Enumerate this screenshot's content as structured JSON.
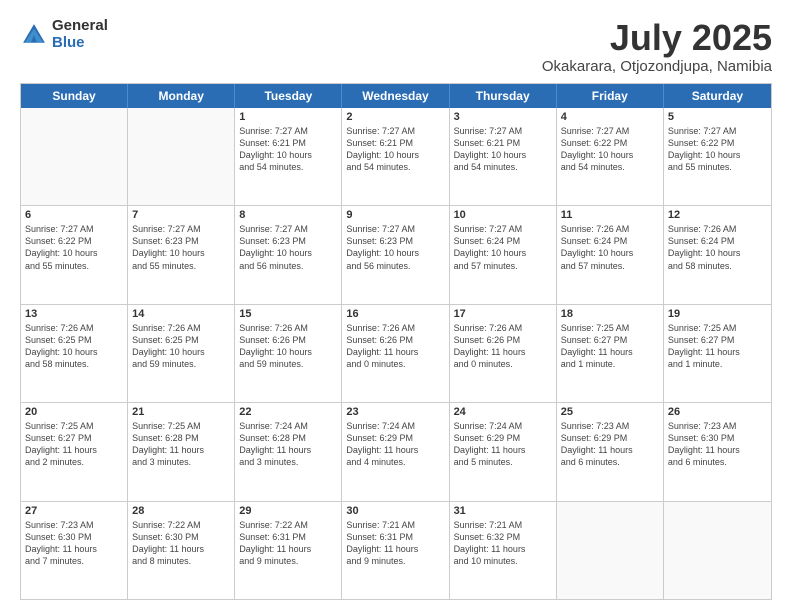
{
  "logo": {
    "general": "General",
    "blue": "Blue"
  },
  "title": "July 2025",
  "subtitle": "Okakarara, Otjozondjupa, Namibia",
  "header_days": [
    "Sunday",
    "Monday",
    "Tuesday",
    "Wednesday",
    "Thursday",
    "Friday",
    "Saturday"
  ],
  "weeks": [
    [
      {
        "day": "",
        "info": ""
      },
      {
        "day": "",
        "info": ""
      },
      {
        "day": "1",
        "info": "Sunrise: 7:27 AM\nSunset: 6:21 PM\nDaylight: 10 hours\nand 54 minutes."
      },
      {
        "day": "2",
        "info": "Sunrise: 7:27 AM\nSunset: 6:21 PM\nDaylight: 10 hours\nand 54 minutes."
      },
      {
        "day": "3",
        "info": "Sunrise: 7:27 AM\nSunset: 6:21 PM\nDaylight: 10 hours\nand 54 minutes."
      },
      {
        "day": "4",
        "info": "Sunrise: 7:27 AM\nSunset: 6:22 PM\nDaylight: 10 hours\nand 54 minutes."
      },
      {
        "day": "5",
        "info": "Sunrise: 7:27 AM\nSunset: 6:22 PM\nDaylight: 10 hours\nand 55 minutes."
      }
    ],
    [
      {
        "day": "6",
        "info": "Sunrise: 7:27 AM\nSunset: 6:22 PM\nDaylight: 10 hours\nand 55 minutes."
      },
      {
        "day": "7",
        "info": "Sunrise: 7:27 AM\nSunset: 6:23 PM\nDaylight: 10 hours\nand 55 minutes."
      },
      {
        "day": "8",
        "info": "Sunrise: 7:27 AM\nSunset: 6:23 PM\nDaylight: 10 hours\nand 56 minutes."
      },
      {
        "day": "9",
        "info": "Sunrise: 7:27 AM\nSunset: 6:23 PM\nDaylight: 10 hours\nand 56 minutes."
      },
      {
        "day": "10",
        "info": "Sunrise: 7:27 AM\nSunset: 6:24 PM\nDaylight: 10 hours\nand 57 minutes."
      },
      {
        "day": "11",
        "info": "Sunrise: 7:26 AM\nSunset: 6:24 PM\nDaylight: 10 hours\nand 57 minutes."
      },
      {
        "day": "12",
        "info": "Sunrise: 7:26 AM\nSunset: 6:24 PM\nDaylight: 10 hours\nand 58 minutes."
      }
    ],
    [
      {
        "day": "13",
        "info": "Sunrise: 7:26 AM\nSunset: 6:25 PM\nDaylight: 10 hours\nand 58 minutes."
      },
      {
        "day": "14",
        "info": "Sunrise: 7:26 AM\nSunset: 6:25 PM\nDaylight: 10 hours\nand 59 minutes."
      },
      {
        "day": "15",
        "info": "Sunrise: 7:26 AM\nSunset: 6:26 PM\nDaylight: 10 hours\nand 59 minutes."
      },
      {
        "day": "16",
        "info": "Sunrise: 7:26 AM\nSunset: 6:26 PM\nDaylight: 11 hours\nand 0 minutes."
      },
      {
        "day": "17",
        "info": "Sunrise: 7:26 AM\nSunset: 6:26 PM\nDaylight: 11 hours\nand 0 minutes."
      },
      {
        "day": "18",
        "info": "Sunrise: 7:25 AM\nSunset: 6:27 PM\nDaylight: 11 hours\nand 1 minute."
      },
      {
        "day": "19",
        "info": "Sunrise: 7:25 AM\nSunset: 6:27 PM\nDaylight: 11 hours\nand 1 minute."
      }
    ],
    [
      {
        "day": "20",
        "info": "Sunrise: 7:25 AM\nSunset: 6:27 PM\nDaylight: 11 hours\nand 2 minutes."
      },
      {
        "day": "21",
        "info": "Sunrise: 7:25 AM\nSunset: 6:28 PM\nDaylight: 11 hours\nand 3 minutes."
      },
      {
        "day": "22",
        "info": "Sunrise: 7:24 AM\nSunset: 6:28 PM\nDaylight: 11 hours\nand 3 minutes."
      },
      {
        "day": "23",
        "info": "Sunrise: 7:24 AM\nSunset: 6:29 PM\nDaylight: 11 hours\nand 4 minutes."
      },
      {
        "day": "24",
        "info": "Sunrise: 7:24 AM\nSunset: 6:29 PM\nDaylight: 11 hours\nand 5 minutes."
      },
      {
        "day": "25",
        "info": "Sunrise: 7:23 AM\nSunset: 6:29 PM\nDaylight: 11 hours\nand 6 minutes."
      },
      {
        "day": "26",
        "info": "Sunrise: 7:23 AM\nSunset: 6:30 PM\nDaylight: 11 hours\nand 6 minutes."
      }
    ],
    [
      {
        "day": "27",
        "info": "Sunrise: 7:23 AM\nSunset: 6:30 PM\nDaylight: 11 hours\nand 7 minutes."
      },
      {
        "day": "28",
        "info": "Sunrise: 7:22 AM\nSunset: 6:30 PM\nDaylight: 11 hours\nand 8 minutes."
      },
      {
        "day": "29",
        "info": "Sunrise: 7:22 AM\nSunset: 6:31 PM\nDaylight: 11 hours\nand 9 minutes."
      },
      {
        "day": "30",
        "info": "Sunrise: 7:21 AM\nSunset: 6:31 PM\nDaylight: 11 hours\nand 9 minutes."
      },
      {
        "day": "31",
        "info": "Sunrise: 7:21 AM\nSunset: 6:32 PM\nDaylight: 11 hours\nand 10 minutes."
      },
      {
        "day": "",
        "info": ""
      },
      {
        "day": "",
        "info": ""
      }
    ]
  ]
}
